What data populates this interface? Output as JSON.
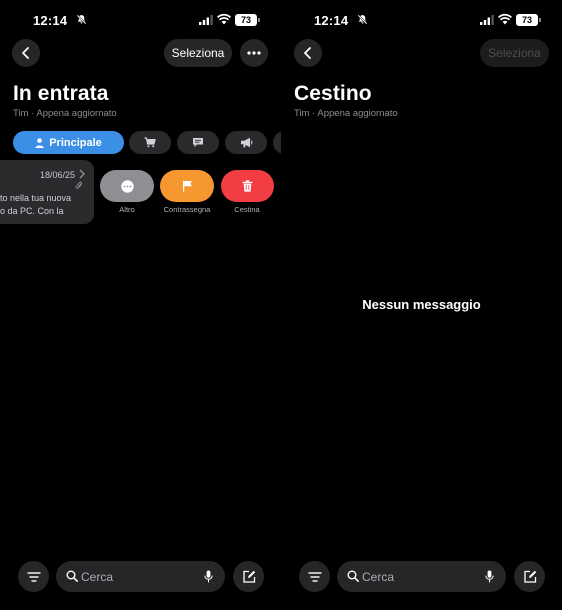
{
  "left_screen": {
    "status": {
      "time": "12:14",
      "battery": "73"
    },
    "nav": {
      "select_label": "Seleziona"
    },
    "title": "In entrata",
    "subtitle": "Tim · Appena aggiornato",
    "chips": [
      {
        "label": "Principale",
        "icon": "person-icon",
        "active": true
      },
      {
        "label": "",
        "icon": "cart-icon"
      },
      {
        "label": "",
        "icon": "chat-bubble-icon"
      },
      {
        "label": "",
        "icon": "megaphone-icon"
      }
    ],
    "message": {
      "date": "18/06/25",
      "line1": "to nella tua nuova",
      "line2": "o da PC. Con la"
    },
    "swipe_actions": [
      {
        "label": "Altro",
        "icon": "more-icon",
        "color": "#8e8e93"
      },
      {
        "label": "Contrassegna",
        "icon": "flag-icon",
        "color": "#f7972f"
      },
      {
        "label": "Cestina",
        "icon": "trash-icon",
        "color": "#f23d44"
      }
    ],
    "search": {
      "placeholder": "Cerca"
    }
  },
  "right_screen": {
    "status": {
      "time": "12:14",
      "battery": "73"
    },
    "nav": {
      "select_label": "Seleziona"
    },
    "title": "Cestino",
    "subtitle": "Tim · Appena aggiornato",
    "empty_message": "Nessun messaggio",
    "search": {
      "placeholder": "Cerca"
    }
  },
  "colors": {
    "accent": "#3b8fe6",
    "background": "#000000",
    "surface": "#262628"
  }
}
